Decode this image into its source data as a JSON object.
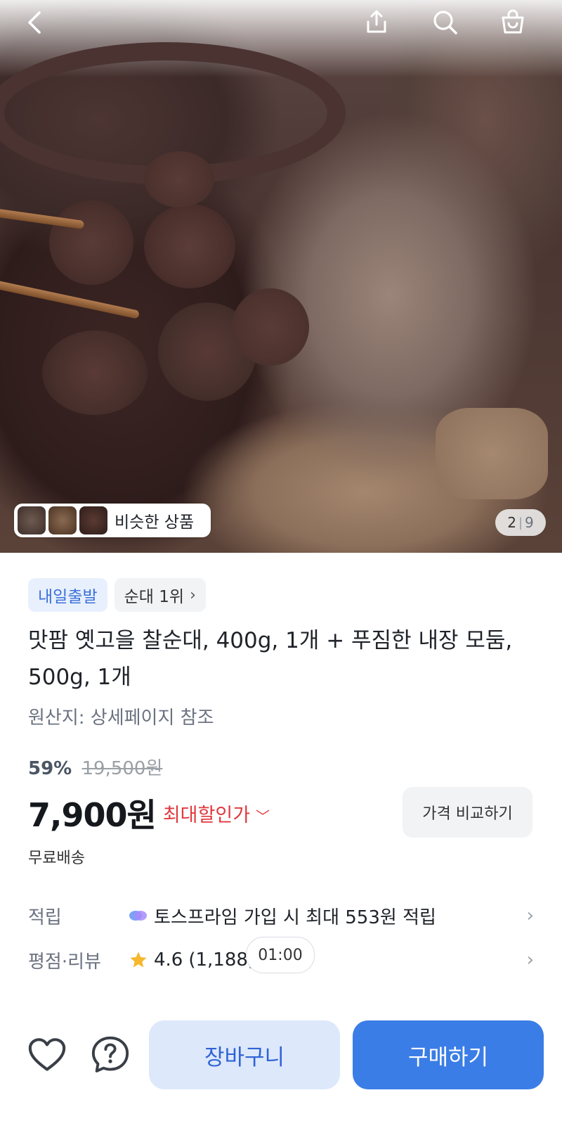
{
  "header": {
    "back_icon": "back-arrow-icon",
    "share_icon": "share-icon",
    "search_icon": "search-icon",
    "cart_icon": "shopping-bag-icon"
  },
  "gallery": {
    "current": "2",
    "total": "9",
    "similar_label": "비슷한 상품"
  },
  "badges": {
    "delivery": "내일출발",
    "rank": "순대 1위"
  },
  "product": {
    "title": "맛팜 옛고을 찰순대, 400g, 1개 + 푸짐한 내장 모둠, 500g, 1개",
    "origin": "원산지: 상세페이지 참조"
  },
  "pricing": {
    "discount": "59%",
    "original_price": "19,500원",
    "price": "7,900원",
    "max_discount_label": "최대할인가",
    "compare_button": "가격 비교하기",
    "shipping": "무료배송"
  },
  "info": {
    "points_key": "적립",
    "points_value": "토스프라임 가입 시 최대 553원 적립",
    "rating_key": "평점·리뷰",
    "rating_value": "4.6",
    "review_count": "(1,188)",
    "timer": "01:00"
  },
  "actions": {
    "cart": "장바구니",
    "buy": "구매하기"
  },
  "colors": {
    "accent": "#3b7de6",
    "accent_light": "#dde8fb",
    "discount_red": "#e0393e",
    "star": "#f5b82e"
  }
}
